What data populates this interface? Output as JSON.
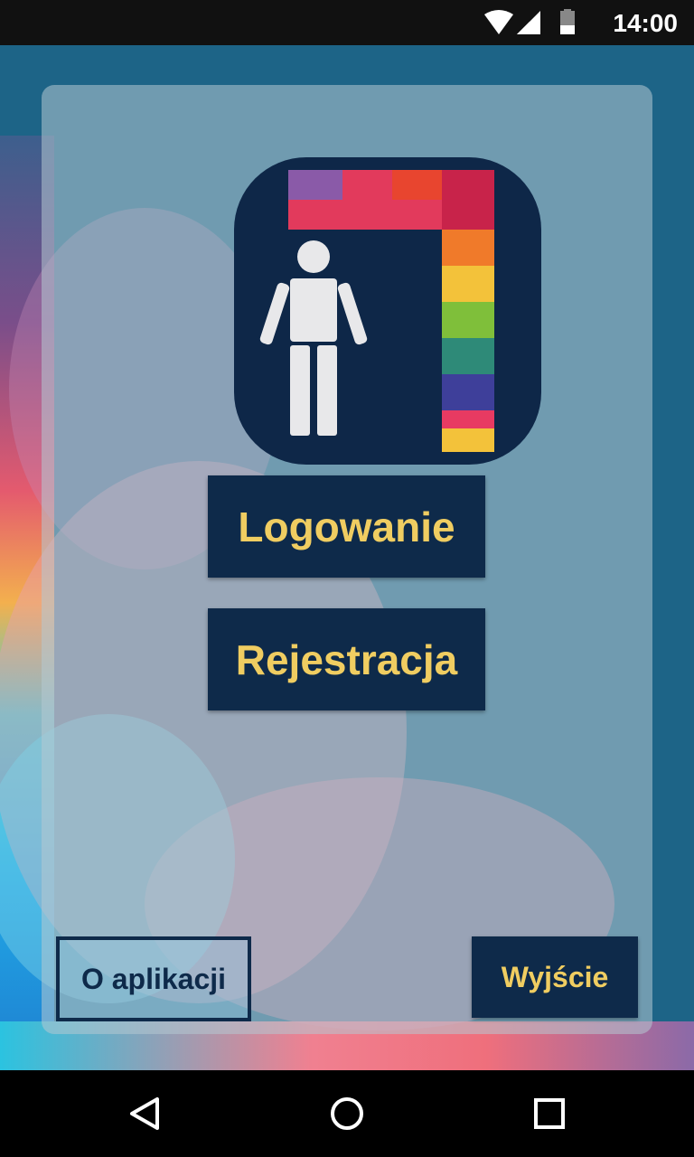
{
  "status_bar": {
    "time": "14:00",
    "icons": [
      "wifi-icon",
      "cell-signal-icon",
      "battery-icon"
    ]
  },
  "logo": {
    "icons": [
      "person-icon",
      "doorway-mosaic-icon"
    ]
  },
  "buttons": {
    "login_label": "Logowanie",
    "register_label": "Rejestracja",
    "about_label": "O aplikacji",
    "exit_label": "Wyjście"
  },
  "nav_bar": {
    "icons": [
      "back-icon",
      "home-icon",
      "recents-icon"
    ]
  },
  "colors": {
    "navy": "#0e2a4a",
    "accent_yellow": "#f0cd61",
    "background_blue": "#1d6487"
  }
}
